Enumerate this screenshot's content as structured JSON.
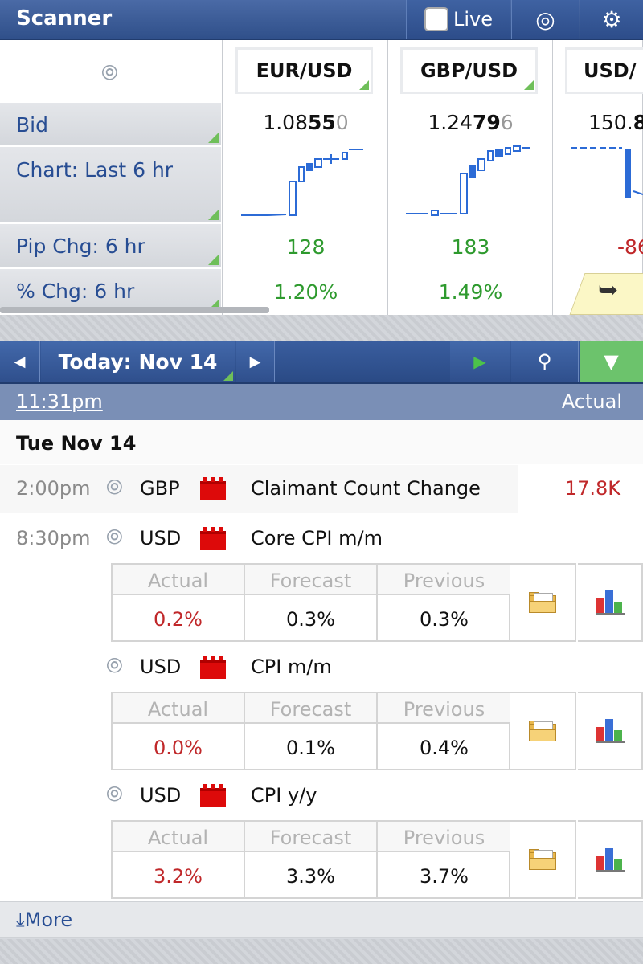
{
  "header": {
    "title": "Scanner",
    "live_label": "Live",
    "icons": [
      "lifebuoy-icon",
      "gear-icon"
    ]
  },
  "scanner": {
    "row_labels": [
      "Bid",
      "Chart: Last 6 hr",
      "Pip Chg: 6 hr",
      "% Chg: 6 hr"
    ],
    "pairs": [
      {
        "symbol": "EUR/USD",
        "bid_pre": "1.08",
        "bid_big": "55",
        "bid_pip": "0",
        "pip_chg": "128",
        "pct_chg": "1.20%"
      },
      {
        "symbol": "GBP/USD",
        "bid_pre": "1.24",
        "bid_big": "79",
        "bid_pip": "6",
        "pip_chg": "183",
        "pct_chg": "1.49%"
      },
      {
        "symbol": "USD/",
        "bid_pre": "150.",
        "bid_big": "8",
        "bid_pip": "",
        "pip_chg": "-86",
        "pct_chg": ""
      }
    ]
  },
  "calendar": {
    "date_label": "Today: Nov 14",
    "time": "11:31pm",
    "actual_label": "Actual",
    "day_heading": "Tue Nov 14",
    "more_label": "More",
    "events": [
      {
        "time": "2:00pm",
        "currency": "GBP",
        "name": "Claimant Count Change",
        "value": "17.8K"
      },
      {
        "time": "8:30pm",
        "currency": "USD",
        "name": "Core CPI m/m",
        "headers": [
          "Actual",
          "Forecast",
          "Previous"
        ],
        "actual": "0.2%",
        "forecast": "0.3%",
        "previous": "0.3%"
      },
      {
        "time": "",
        "currency": "USD",
        "name": "CPI m/m",
        "headers": [
          "Actual",
          "Forecast",
          "Previous"
        ],
        "actual": "0.0%",
        "forecast": "0.1%",
        "previous": "0.4%"
      },
      {
        "time": "",
        "currency": "USD",
        "name": "CPI y/y",
        "headers": [
          "Actual",
          "Forecast",
          "Previous"
        ],
        "actual": "3.2%",
        "forecast": "3.3%",
        "previous": "3.7%"
      }
    ]
  },
  "colors": {
    "accent": "#30508a",
    "positive": "#2e9a2e",
    "negative": "#c0282a",
    "filter_active": "#6cc36c"
  }
}
